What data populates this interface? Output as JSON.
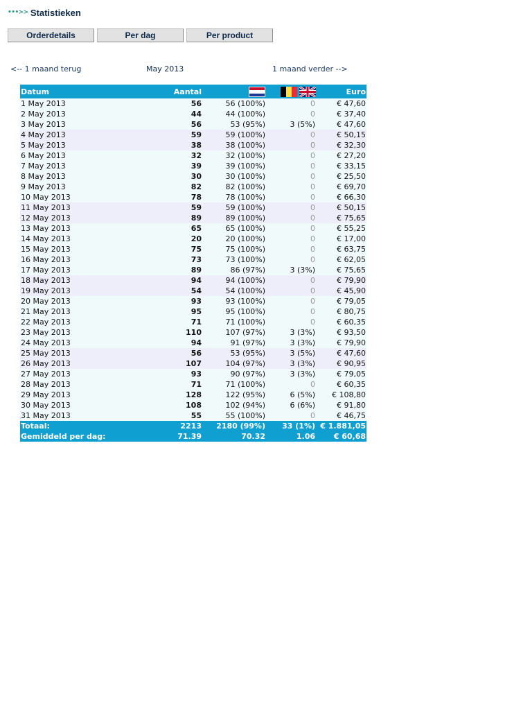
{
  "header": {
    "arrow": "•••>>",
    "title": "Statistieken"
  },
  "tabs": [
    {
      "label": "Orderdetails"
    },
    {
      "label": "Per dag"
    },
    {
      "label": "Per product"
    }
  ],
  "nav": {
    "prev": "<-- 1 maand terug",
    "current": "May 2013",
    "next": "1 maand verder -->"
  },
  "table": {
    "headers": {
      "date": "Datum",
      "count": "Aantal",
      "nl_flag": "nl-flag-icon",
      "be_flag": "be-flag-icon",
      "uk_flag": "uk-flag-icon",
      "euro": "Euro"
    },
    "rows": [
      [
        "1 May 2013",
        "56",
        "56 (100%)",
        "0",
        "€ 47,60"
      ],
      [
        "2 May 2013",
        "44",
        "44 (100%)",
        "0",
        "€ 37,40"
      ],
      [
        "3 May 2013",
        "56",
        "53 (95%)",
        "3 (5%)",
        "€ 47,60"
      ],
      [
        "4 May 2013",
        "59",
        "59 (100%)",
        "0",
        "€ 50,15"
      ],
      [
        "5 May 2013",
        "38",
        "38 (100%)",
        "0",
        "€ 32,30"
      ],
      [
        "6 May 2013",
        "32",
        "32 (100%)",
        "0",
        "€ 27,20"
      ],
      [
        "7 May 2013",
        "39",
        "39 (100%)",
        "0",
        "€ 33,15"
      ],
      [
        "8 May 2013",
        "30",
        "30 (100%)",
        "0",
        "€ 25,50"
      ],
      [
        "9 May 2013",
        "82",
        "82 (100%)",
        "0",
        "€ 69,70"
      ],
      [
        "10 May 2013",
        "78",
        "78 (100%)",
        "0",
        "€ 66,30"
      ],
      [
        "11 May 2013",
        "59",
        "59 (100%)",
        "0",
        "€ 50,15"
      ],
      [
        "12 May 2013",
        "89",
        "89 (100%)",
        "0",
        "€ 75,65"
      ],
      [
        "13 May 2013",
        "65",
        "65 (100%)",
        "0",
        "€ 55,25"
      ],
      [
        "14 May 2013",
        "20",
        "20 (100%)",
        "0",
        "€ 17,00"
      ],
      [
        "15 May 2013",
        "75",
        "75 (100%)",
        "0",
        "€ 63,75"
      ],
      [
        "16 May 2013",
        "73",
        "73 (100%)",
        "0",
        "€ 62,05"
      ],
      [
        "17 May 2013",
        "89",
        "86 (97%)",
        "3 (3%)",
        "€ 75,65"
      ],
      [
        "18 May 2013",
        "94",
        "94 (100%)",
        "0",
        "€ 79,90"
      ],
      [
        "19 May 2013",
        "54",
        "54 (100%)",
        "0",
        "€ 45,90"
      ],
      [
        "20 May 2013",
        "93",
        "93 (100%)",
        "0",
        "€ 79,05"
      ],
      [
        "21 May 2013",
        "95",
        "95 (100%)",
        "0",
        "€ 80,75"
      ],
      [
        "22 May 2013",
        "71",
        "71 (100%)",
        "0",
        "€ 60,35"
      ],
      [
        "23 May 2013",
        "110",
        "107 (97%)",
        "3 (3%)",
        "€ 93,50"
      ],
      [
        "24 May 2013",
        "94",
        "91 (97%)",
        "3 (3%)",
        "€ 79,90"
      ],
      [
        "25 May 2013",
        "56",
        "53 (95%)",
        "3 (5%)",
        "€ 47,60"
      ],
      [
        "26 May 2013",
        "107",
        "104 (97%)",
        "3 (3%)",
        "€ 90,95"
      ],
      [
        "27 May 2013",
        "93",
        "90 (97%)",
        "3 (3%)",
        "€ 79,05"
      ],
      [
        "28 May 2013",
        "71",
        "71 (100%)",
        "0",
        "€ 60,35"
      ],
      [
        "29 May 2013",
        "128",
        "122 (95%)",
        "6 (5%)",
        "€ 108,80"
      ],
      [
        "30 May 2013",
        "108",
        "102 (94%)",
        "6 (6%)",
        "€ 91,80"
      ],
      [
        "31 May 2013",
        "55",
        "55 (100%)",
        "0",
        "€ 46,75"
      ]
    ],
    "totals": {
      "label": "Totaal:",
      "count": "2213",
      "nl": "2180 (99%)",
      "other": "33 (1%)",
      "euro": "€ 1.881,05"
    },
    "average": {
      "label": "Gemiddeld per dag:",
      "count": "71.39",
      "nl": "70.32",
      "other": "1.06",
      "euro": "€ 60,68"
    }
  },
  "colors": {
    "header_bg": "#0f9fd0",
    "row_odd": "#f0fafa",
    "row_even": "#eeeefa",
    "title": "#0e2a4a",
    "arrow": "#2e9b8a"
  }
}
